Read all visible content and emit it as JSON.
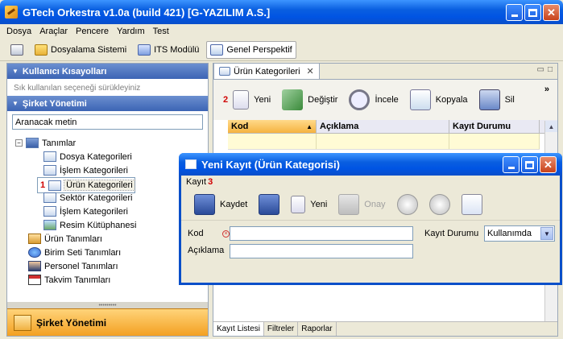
{
  "window": {
    "title": "GTech Orkestra v1.0a (build 421) [G-YAZILIM A.S.]",
    "minimize_glyph": "_",
    "maximize_glyph": "□",
    "close_glyph": "✕"
  },
  "menubar": {
    "items": [
      "Dosya",
      "Araçlar",
      "Pencere",
      "Yardım",
      "Test"
    ]
  },
  "toolbar": {
    "items": [
      {
        "label": "Dosyalama Sistemi",
        "icon": "folder-icon"
      },
      {
        "label": "ITS Modülü",
        "icon": "its-icon"
      },
      {
        "label": "Genel Perspektif",
        "icon": "perspective-icon",
        "active": true
      }
    ]
  },
  "left_panel": {
    "section1_title": "Kullanıcı Kısayolları",
    "section1_hint": "Sık kullanılan seçeneği sürükleyiniz",
    "section2_title": "Şirket Yönetimi",
    "search_value": "Aranacak metin",
    "tree": {
      "root_label": "Tanımlar",
      "children": [
        "Dosya Kategorileri",
        "İşlem Kategorileri",
        "Ürün Kategorileri",
        "Sektör Kategorileri",
        "İşlem Kategorileri",
        "Resim Kütüphanesi"
      ],
      "selected_marker": "1",
      "others": [
        "Ürün Tanımları",
        "Birim Seti Tanımları",
        "Personel Tanımları",
        "Takvim Tanımları"
      ]
    },
    "footer_label": "Şirket Yönetimi"
  },
  "right_panel": {
    "tab_label": "Ürün Kategorileri",
    "tab_close": "✕",
    "overflow_glyph": "»",
    "toolbar": {
      "marker": "2",
      "items": [
        "Yeni",
        "Değiştir",
        "İncele",
        "Kopyala",
        "Sil"
      ]
    },
    "grid_headers": [
      "Kod",
      "Açıklama",
      "Kayıt Durumu"
    ],
    "bottom_tabs": [
      "Kayıt Listesi",
      "Filtreler",
      "Raporlar"
    ]
  },
  "dialog": {
    "title": "Yeni Kayıt (Ürün Kategorisi)",
    "menu_label": "Kayıt",
    "menu_marker": "3",
    "tools": [
      "Kaydet",
      "",
      "Yeni",
      "Onay"
    ],
    "form": {
      "kod_label": "Kod",
      "kod_value": "",
      "aciklama_label": "Açıklama",
      "aciklama_value": "",
      "status_label": "Kayıt Durumu",
      "status_value": "Kullanımda"
    }
  },
  "colors": {
    "titlebar": "#0054e3",
    "accent": "#ffa733",
    "grid_row": "#fffbd5",
    "marker_red": "#d00000"
  }
}
